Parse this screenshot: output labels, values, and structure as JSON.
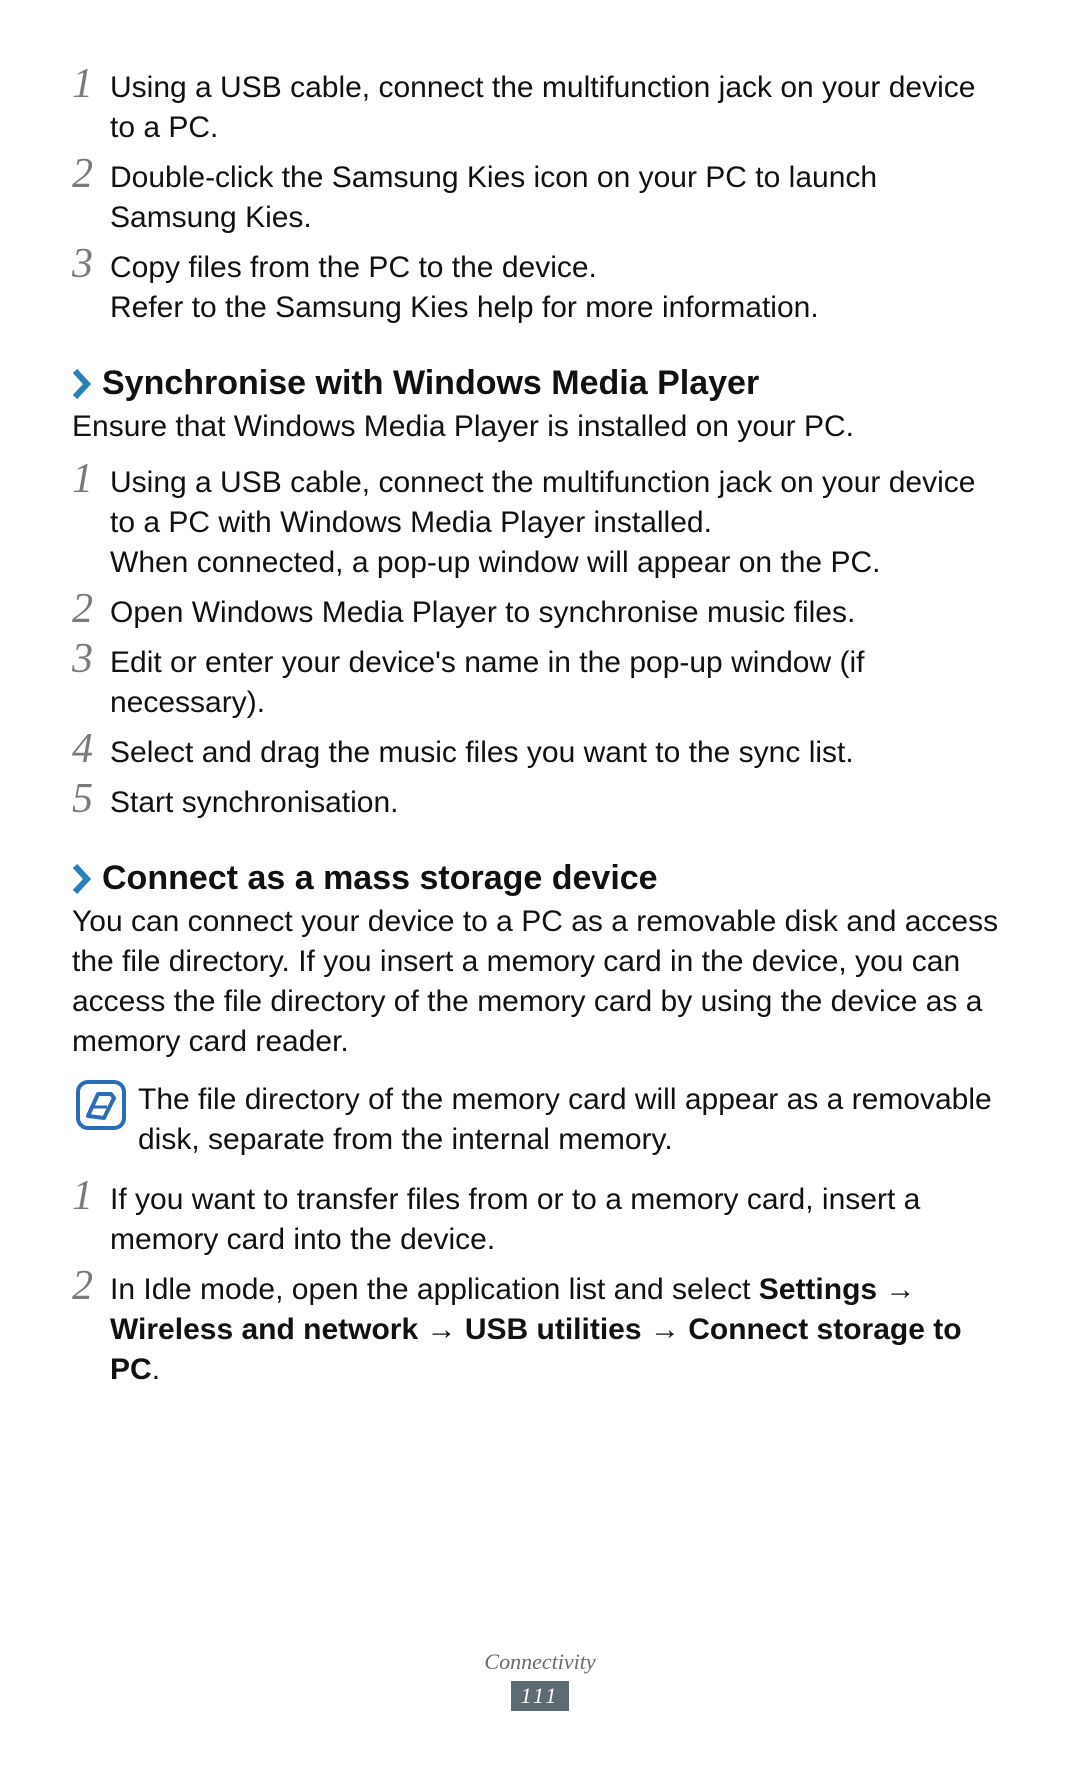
{
  "top_steps": [
    {
      "num": "1",
      "text": "Using a USB cable, connect the multifunction jack on your device to a PC."
    },
    {
      "num": "2",
      "text": "Double-click the Samsung Kies icon on your PC to launch Samsung Kies."
    },
    {
      "num": "3",
      "text": "Copy files from the PC to the device.\nRefer to the Samsung Kies help for more information."
    }
  ],
  "section_wmp": {
    "heading": "Synchronise with Windows Media Player",
    "intro": "Ensure that Windows Media Player is installed on your PC.",
    "steps": [
      {
        "num": "1",
        "text": "Using a USB cable, connect the multifunction jack on your device to a PC with Windows Media Player installed.\nWhen connected, a pop-up window will appear on the PC."
      },
      {
        "num": "2",
        "text": "Open Windows Media Player to synchronise music files."
      },
      {
        "num": "3",
        "text": "Edit or enter your device's name in the pop-up window (if necessary)."
      },
      {
        "num": "4",
        "text": "Select and drag the music files you want to the sync list."
      },
      {
        "num": "5",
        "text": "Start synchronisation."
      }
    ]
  },
  "section_mass": {
    "heading": "Connect as a mass storage device",
    "intro": "You can connect your device to a PC as a removable disk and access the file directory. If you insert a memory card in the device, you can access the file directory of the memory card by using the device as a memory card reader.",
    "note": "The file directory of the memory card will appear as a removable disk, separate from the internal memory.",
    "steps": {
      "s1": {
        "num": "1",
        "text": "If you want to transfer files from or to a memory card, insert a memory card into the device."
      },
      "s2": {
        "num": "2",
        "prefix": "In Idle mode, open the application list and select ",
        "b1": "Settings",
        "a1": " → ",
        "b2": "Wireless and network",
        "a2": " → ",
        "b3": "USB utilities",
        "a3": " → ",
        "b4": "Connect storage to PC",
        "suffix": "."
      }
    }
  },
  "footer": {
    "chapter": "Connectivity",
    "page": "111"
  }
}
